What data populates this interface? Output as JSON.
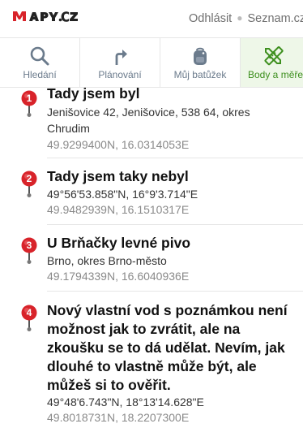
{
  "header": {
    "logo_text": "MAPY.CZ",
    "links": [
      "Odhlásit",
      "Seznam.cz"
    ]
  },
  "tabs": [
    {
      "label": "Hledání",
      "icon": "search-icon"
    },
    {
      "label": "Plánování",
      "icon": "route-arrow-icon"
    },
    {
      "label": "Můj batůžek",
      "icon": "backpack-icon"
    },
    {
      "label": "Body a měření",
      "icon": "ruler-pencil-icon",
      "active": true
    }
  ],
  "colors": {
    "pin_red": "#d8232a",
    "active_tab_green": "#3d8f1e",
    "active_tab_bg": "#eef7e8"
  },
  "points": [
    {
      "number": "1",
      "title": "Tady jsem byl",
      "address": "Jenišovice 42, Jenišovice, 538 64, okres Chrudim",
      "coords": "49.9299400N, 16.0314053E"
    },
    {
      "number": "2",
      "title": "Tady jsem taky nebyl",
      "address": "49°56'53.858\"N, 16°9'3.714\"E",
      "coords": "49.9482939N, 16.1510317E"
    },
    {
      "number": "3",
      "title": "U Brňačky levné pivo",
      "address": "Brno, okres Brno-město",
      "coords": "49.1794339N, 16.6040936E"
    },
    {
      "number": "4",
      "title": "Nový vlastní vod s poznámkou není možnost jak to zvrátit, ale na zkoušku se to dá udělat. Nevím, jak dlouhé to vlastně může být, ale můžeš si to ověřit.",
      "address": "49°48'6.743\"N, 18°13'14.628\"E",
      "coords": "49.8018731N, 18.2207300E"
    }
  ]
}
